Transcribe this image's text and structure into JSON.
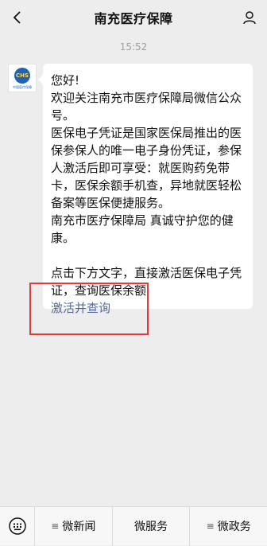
{
  "nav": {
    "title": "南充医疗保障",
    "back_icon": "chevron-left-icon",
    "profile_icon": "person-icon"
  },
  "chat": {
    "timestamp": "15:52",
    "message": {
      "lines": [
        "您好!",
        "欢迎关注南充市医疗保障局微信公众号。",
        "医保电子凭证是国家医保局推出的医保参保人的唯一电子身份凭证，参保人激活后即可享受：就医购药免带卡，医保余额手机查，异地就医轻松备案等医保便捷服务。",
        "南充市医疗保障局 真诚守护您的健康。",
        "点击下方文字，直接激活医保电子凭证，查询医保余额"
      ],
      "link": "激活并查询"
    }
  },
  "bottom_menu": {
    "keyboard_icon": "keyboard-icon",
    "items": [
      "微新闻",
      "微服务",
      "微政务"
    ]
  },
  "colors": {
    "link": "#576b95",
    "highlight": "#e53935",
    "background": "#ededed"
  }
}
